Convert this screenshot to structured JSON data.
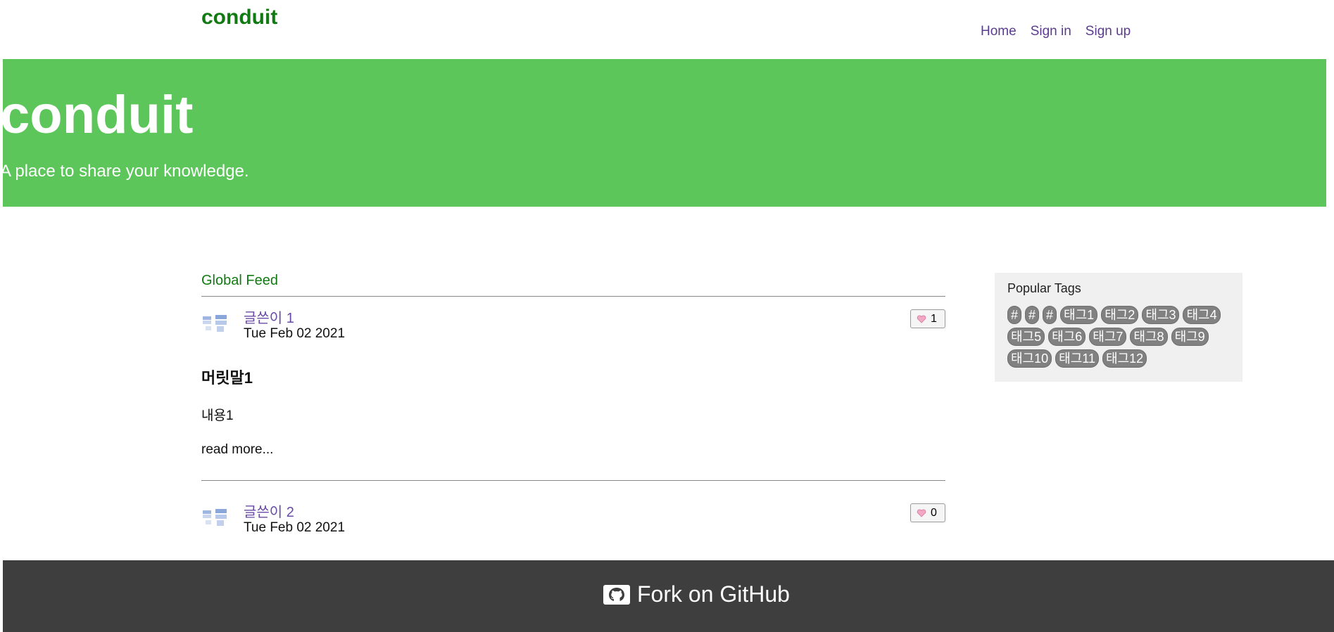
{
  "navbar": {
    "brand": "conduit",
    "links": [
      "Home",
      "Sign in",
      "Sign up"
    ]
  },
  "banner": {
    "title": "conduit",
    "subtitle": "A place to share your knowledge."
  },
  "feed": {
    "tab_label": "Global Feed",
    "articles": [
      {
        "author": "글쓴이 1",
        "date": "Tue Feb 02 2021",
        "likes": "1",
        "title": "머릿말1",
        "body": "내용1",
        "read_more": "read more..."
      },
      {
        "author": "글쓴이 2",
        "date": "Tue Feb 02 2021",
        "likes": "0"
      }
    ]
  },
  "sidebar": {
    "title": "Popular Tags",
    "tags": [
      "#",
      "#",
      "#",
      "태그1",
      "태그2",
      "태그3",
      "태그4",
      "태그5",
      "태그6",
      "태그7",
      "태그8",
      "태그9",
      "태그10",
      "태그11",
      "태그12"
    ]
  },
  "footer": {
    "link_label": "Fork on GitHub",
    "icon": "github-icon"
  },
  "colors": {
    "brand_green": "#127a12",
    "banner_green": "#5cc65a",
    "link_purple": "#5b3b8f",
    "footer_bg": "#3e3e3e",
    "tag_bg": "#818181"
  }
}
